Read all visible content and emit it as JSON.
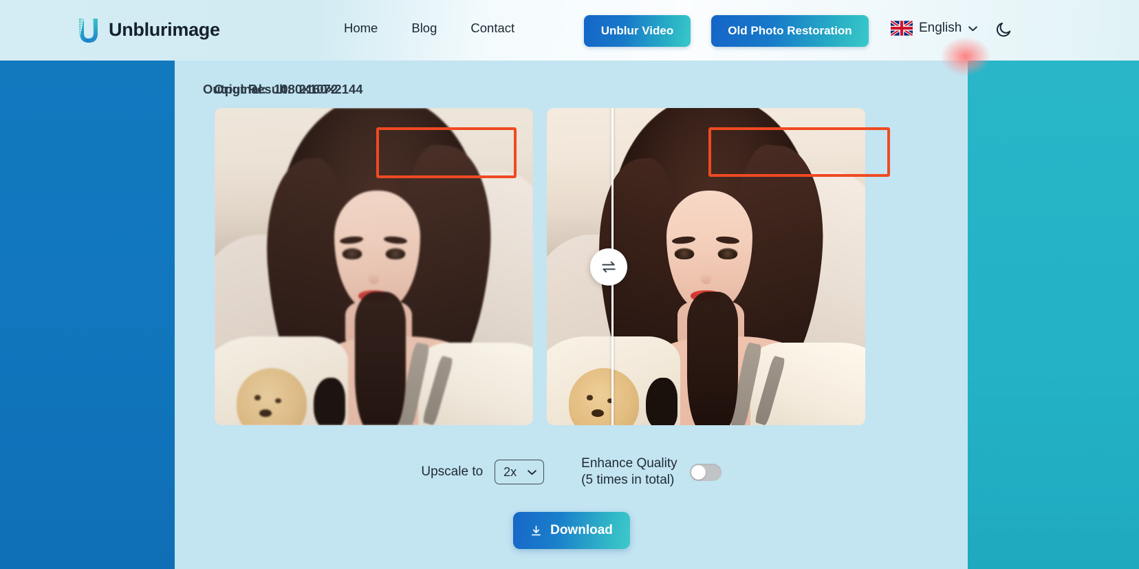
{
  "brand": {
    "name": "Unblurimage",
    "logo_icon": "u-logo-icon"
  },
  "nav": {
    "items": [
      {
        "label": "Home"
      },
      {
        "label": "Blog"
      },
      {
        "label": "Contact"
      }
    ]
  },
  "header_actions": {
    "unblur_video_label": "Unblur Video",
    "old_photo_restoration_label": "Old Photo Restoration",
    "language_label": "English",
    "language_flag_icon": "uk-flag-icon",
    "chevron_icon": "chevron-down-icon",
    "theme_toggle_icon": "moon-icon"
  },
  "comparison": {
    "original": {
      "label": "Original:",
      "dimensions": "1080×1072"
    },
    "output": {
      "label": "Output Result:",
      "dimensions": "2160×2144"
    },
    "slider_handle_icon": "swap-horizontal-icon"
  },
  "controls": {
    "upscale_label": "Upscale to",
    "upscale_value": "2x",
    "upscale_options": [
      "2x"
    ],
    "enhance_line1": "Enhance Quality",
    "enhance_line2": "(5 times in total)",
    "enhance_enabled": false
  },
  "download": {
    "label": "Download",
    "icon": "download-icon"
  },
  "colors": {
    "band_left": "#1176bd",
    "band_right": "#23b2c6",
    "content_bg": "#c3e4f1",
    "accent_gradient_start": "#1565c7",
    "accent_gradient_end": "#39c9c9",
    "annotation_red": "#ef4a22",
    "toggle_off": "#c0c4c6"
  }
}
